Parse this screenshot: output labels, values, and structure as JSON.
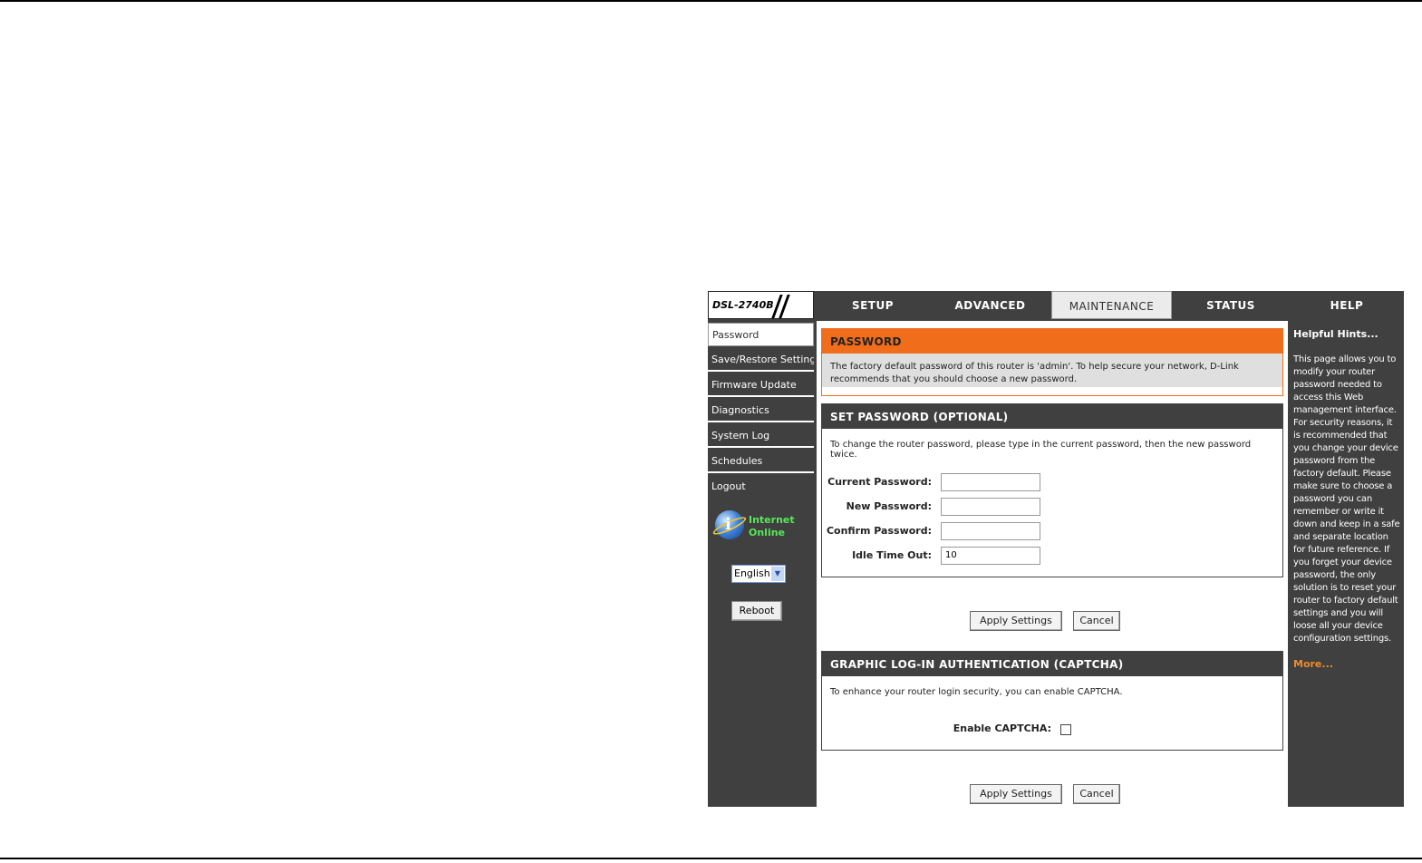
{
  "header": {
    "model": "DSL-2740B",
    "tabs": [
      {
        "label": "SETUP"
      },
      {
        "label": "ADVANCED"
      },
      {
        "label": "MAINTENANCE"
      },
      {
        "label": "STATUS"
      },
      {
        "label": "HELP"
      }
    ]
  },
  "sidebar": {
    "items": [
      {
        "label": "Password"
      },
      {
        "label": "Save/Restore Settings"
      },
      {
        "label": "Firmware Update"
      },
      {
        "label": "Diagnostics"
      },
      {
        "label": "System Log"
      },
      {
        "label": "Schedules"
      },
      {
        "label": "Logout"
      }
    ],
    "status_line1": "Internet",
    "status_line2": "Online",
    "language": "English",
    "reboot_label": "Reboot"
  },
  "password_section": {
    "title": "PASSWORD",
    "description": "The factory default password of this router is 'admin'. To help secure your network, D-Link recommends that you should choose a new password."
  },
  "set_password": {
    "title": "SET PASSWORD (OPTIONAL)",
    "description": "To change the router password, please type in the current password, then the new password twice.",
    "current_label": "Current Password:",
    "current_value": "",
    "new_label": "New Password:",
    "new_value": "",
    "confirm_label": "Confirm Password:",
    "confirm_value": "",
    "idle_label": "Idle Time Out:",
    "idle_value": "10"
  },
  "buttons": {
    "apply": "Apply Settings",
    "cancel": "Cancel"
  },
  "captcha": {
    "title": "GRAPHIC LOG-IN AUTHENTICATION (CAPTCHA)",
    "description": "To enhance your router login security, you can enable CAPTCHA.",
    "enable_label": "Enable CAPTCHA:",
    "enabled": false
  },
  "help": {
    "title": "Helpful Hints...",
    "text": "This page allows you to modify your router password needed to access this Web management interface. For security reasons, it is recommended that you change your device password from the factory default. Please make sure to choose a password you can remember or write it down and keep in a safe and separate location for future reference. If you forget your device password, the only solution is to reset your router to factory default settings and you will loose all your device configuration settings.",
    "more": "More..."
  },
  "colors": {
    "frame": "#404040",
    "accent_orange": "#f06d1c",
    "online_green": "#56e856",
    "more_link": "#f08a2c"
  }
}
